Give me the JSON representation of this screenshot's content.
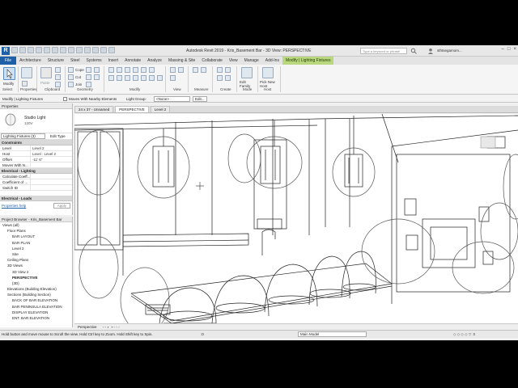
{
  "title_bar": {
    "title": "Autodesk Revit 2019 - Kris_Basement Bar - 3D View: PERSPECTIVE",
    "search_placeholder": "Type a keyword or phrase",
    "user": "sthtsegamom..."
  },
  "menu_tabs": [
    "File",
    "Architecture",
    "Structure",
    "Steel",
    "Systems",
    "Insert",
    "Annotate",
    "Analyze",
    "Massing & Site",
    "Collaborate",
    "View",
    "Manage",
    "Add-Ins",
    "Modify | Lighting Fixtures"
  ],
  "ribbon": {
    "modify_label": "Modify",
    "clipboard": {
      "paste": "Paste"
    },
    "geometry": {
      "cope": "Cope",
      "cut": "Cut",
      "join": "Join"
    },
    "mode": {
      "edit_family": "Edit Family"
    },
    "host": {
      "pick_new_host": "Pick New Host"
    },
    "panels": [
      "Select",
      "Properties",
      "Clipboard",
      "Geometry",
      "Modify",
      "View",
      "Measure",
      "Create",
      "Mode",
      "Host"
    ]
  },
  "options_bar": {
    "context": "Modify | Lighting Fixtures",
    "moves_with_nearby": "Moves With Nearby Elements",
    "light_group_label": "Light Group:",
    "light_group_value": "<None>",
    "edit": "Edit..."
  },
  "properties": {
    "header": "Properties",
    "type_name": "Studio Light",
    "type_sub": "120V",
    "selector": "Lighting Fixtures (3)",
    "edit_type": "Edit Type",
    "sections": {
      "constraints": "Constraints",
      "electrical_lighting": "Electrical - Lighting",
      "electrical_loads": "Electrical - Loads"
    },
    "rows_constraints": [
      {
        "k": "Level",
        "v": "Level 2"
      },
      {
        "k": "Host",
        "v": "Level : Level 2"
      },
      {
        "k": "Offset",
        "v": "-11' 6\""
      },
      {
        "k": "Moves With N...",
        "v": ""
      }
    ],
    "rows_lighting": [
      {
        "k": "Calculate Coeff...",
        "v": ""
      },
      {
        "k": "Coefficient of ...",
        "v": ""
      },
      {
        "k": "Switch ID",
        "v": ""
      }
    ],
    "help_link": "Properties help",
    "apply": "Apply"
  },
  "project_browser": {
    "header": "Project Browser - Kris_Basement Bar",
    "items": [
      {
        "label": "Views (all)",
        "indent": 0,
        "bold": false
      },
      {
        "label": "Floor Plans",
        "indent": 1,
        "bold": false
      },
      {
        "label": "BAR LAYOUT",
        "indent": 2,
        "bold": false
      },
      {
        "label": "BAR PLAN",
        "indent": 2,
        "bold": false
      },
      {
        "label": "Level 2",
        "indent": 2,
        "bold": false
      },
      {
        "label": "Site",
        "indent": 2,
        "bold": false
      },
      {
        "label": "Ceiling Plans",
        "indent": 1,
        "bold": false
      },
      {
        "label": "3D Views",
        "indent": 1,
        "bold": false
      },
      {
        "label": "3D View 2",
        "indent": 2,
        "bold": false
      },
      {
        "label": "PERSPECTIVE",
        "indent": 2,
        "bold": true
      },
      {
        "label": "{3D}",
        "indent": 2,
        "bold": false
      },
      {
        "label": "Elevations (Building Elevation)",
        "indent": 1,
        "bold": false
      },
      {
        "label": "Sections (Building Section)",
        "indent": 1,
        "bold": false
      },
      {
        "label": "BACK OF BAR ELEVATION",
        "indent": 2,
        "bold": false
      },
      {
        "label": "BAR PENINSULA ELEVATION",
        "indent": 2,
        "bold": false
      },
      {
        "label": "DISPLAY ELEVATION",
        "indent": 2,
        "bold": false
      },
      {
        "label": "ENT. BAR ELEVATION",
        "indent": 2,
        "bold": false
      }
    ]
  },
  "view_tabs": [
    {
      "label": "24 x 37 - Unnamed",
      "active": false
    },
    {
      "label": "PERSPECTIVE",
      "active": true
    },
    {
      "label": "Level 2",
      "active": false
    }
  ],
  "view_control": {
    "view_type": "Perspective"
  },
  "status_bar": {
    "message": "Hold button and move mouse to Scroll the view. Hold Ctrl key to Zoom. Hold Shift key to Spin.",
    "value": ":0",
    "model": "Main Model"
  }
}
